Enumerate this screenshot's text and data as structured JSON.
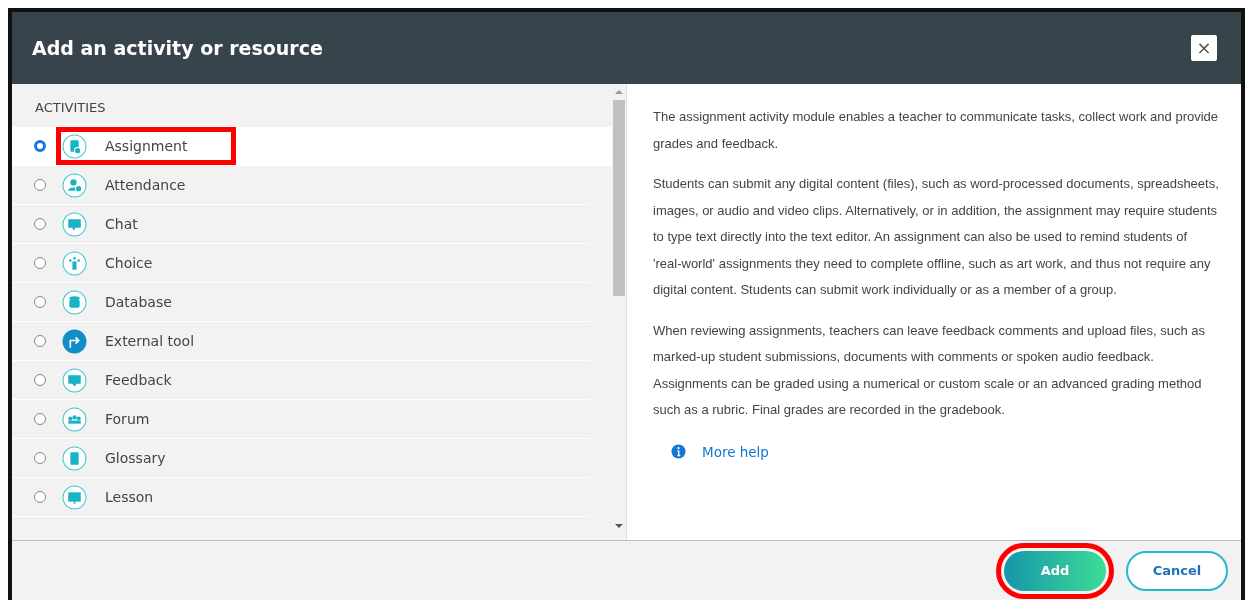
{
  "dialog": {
    "title": "Add an activity or resource",
    "close_label": "×"
  },
  "section_heading": "ACTIVITIES",
  "activities": [
    {
      "label": "Assignment",
      "selected": true,
      "highlighted": true
    },
    {
      "label": "Attendance",
      "selected": false,
      "highlighted": false
    },
    {
      "label": "Chat",
      "selected": false,
      "highlighted": false
    },
    {
      "label": "Choice",
      "selected": false,
      "highlighted": false
    },
    {
      "label": "Database",
      "selected": false,
      "highlighted": false
    },
    {
      "label": "External tool",
      "selected": false,
      "highlighted": false
    },
    {
      "label": "Feedback",
      "selected": false,
      "highlighted": false
    },
    {
      "label": "Forum",
      "selected": false,
      "highlighted": false
    },
    {
      "label": "Glossary",
      "selected": false,
      "highlighted": false
    },
    {
      "label": "Lesson",
      "selected": false,
      "highlighted": false
    }
  ],
  "description": [
    "The assignment activity module enables a teacher to communicate tasks, collect work and provide grades and feedback.",
    "Students can submit any digital content (files), such as word-processed documents, spreadsheets, images, or audio and video clips. Alternatively, or in addition, the assignment may require students to type text directly into the text editor. An assignment can also be used to remind students of 'real-world' assignments they need to complete offline, such as art work, and thus not require any digital content. Students can submit work individually or as a member of a group.",
    "When reviewing assignments, teachers can leave feedback comments and upload files, such as marked-up student submissions, documents with comments or spoken audio feedback. Assignments can be graded using a numerical or custom scale or an advanced grading method such as a rubric. Final grades are recorded in the gradebook."
  ],
  "more_help": "More help",
  "buttons": [
    {
      "label": "Add",
      "kind": "primary",
      "highlighted": true
    },
    {
      "label": "Cancel",
      "kind": "secondary",
      "highlighted": false
    }
  ]
}
